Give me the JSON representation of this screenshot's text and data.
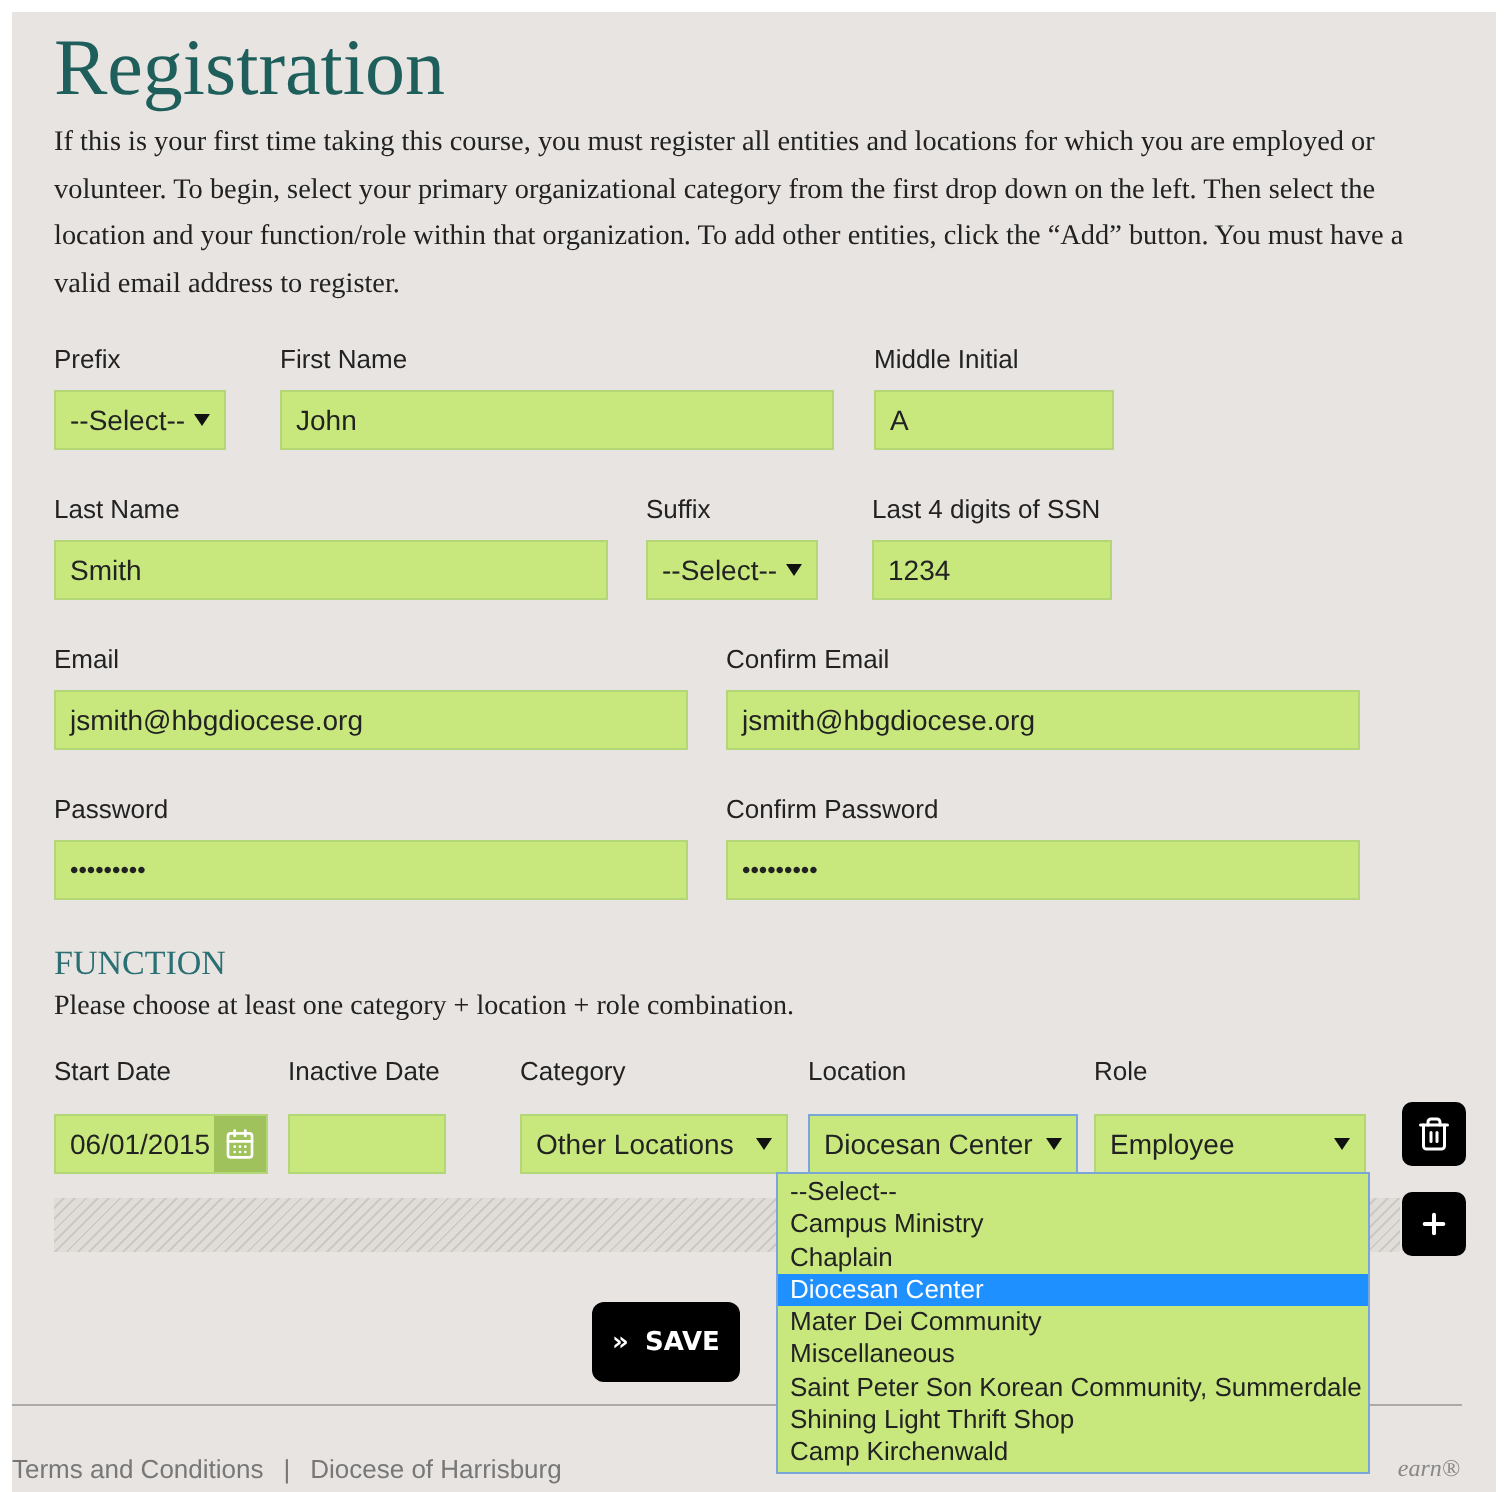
{
  "title": "Registration",
  "intro": "If this is your first time taking this course, you must register all entities and locations for which you are employed or volunteer. To begin, select your primary organizational category from the first drop down on the left. Then select the location and your function/role within that organization. To add other entities, click the “Add” button. You must have a valid email address to register.",
  "personal_rows": [
    [
      {
        "label": "Prefix",
        "kind": "select",
        "value": "--Select--"
      },
      {
        "label": "First Name",
        "kind": "text",
        "value": "John"
      },
      {
        "label": "Middle Initial",
        "kind": "text",
        "value": "A"
      }
    ],
    [
      {
        "label": "Last Name",
        "kind": "text",
        "value": "Smith"
      },
      {
        "label": "Suffix",
        "kind": "select",
        "value": "--Select--"
      },
      {
        "label": "Last 4 digits of SSN",
        "kind": "text",
        "value": "1234"
      }
    ],
    [
      {
        "label": "Email",
        "kind": "text",
        "value": "jsmith@hbgdiocese.org"
      },
      {
        "label": "Confirm Email",
        "kind": "text",
        "value": "jsmith@hbgdiocese.org"
      }
    ],
    [
      {
        "label": "Password",
        "kind": "password",
        "value": "•••••••••"
      },
      {
        "label": "Confirm Password",
        "kind": "password",
        "value": "•••••••••"
      }
    ]
  ],
  "function": {
    "title": "FUNCTION",
    "instruction": "Please choose at least one category + location + role combination.",
    "columns": [
      "Start Date",
      "Inactive Date",
      "Category",
      "Location",
      "Role"
    ],
    "entry": {
      "start_date": "06/01/2015",
      "category": "Other Locations",
      "location": "Diocesan Center",
      "role": "Employee",
      "location_expanded": true
    },
    "location_options": [
      {
        "label": "--Select--",
        "selected": false
      },
      {
        "label": "Campus Ministry",
        "selected": false
      },
      {
        "label": "Chaplain",
        "selected": false
      },
      {
        "label": "Diocesan Center",
        "selected": true
      },
      {
        "label": "Mater Dei Community",
        "selected": false
      },
      {
        "label": "Miscellaneous",
        "selected": false
      },
      {
        "label": "Saint Peter Son Korean Community, Summerdale",
        "selected": false
      },
      {
        "label": "Shining Light Thrift Shop",
        "selected": false
      },
      {
        "label": "Camp Kirchenwald",
        "selected": false
      }
    ]
  },
  "save_button": {
    "icon": "»",
    "label": "SAVE"
  },
  "footer": {
    "links": [
      "Terms and Conditions",
      "Diocese of Harrisburg"
    ],
    "separator": "|",
    "brand_fragment": "earn®"
  }
}
